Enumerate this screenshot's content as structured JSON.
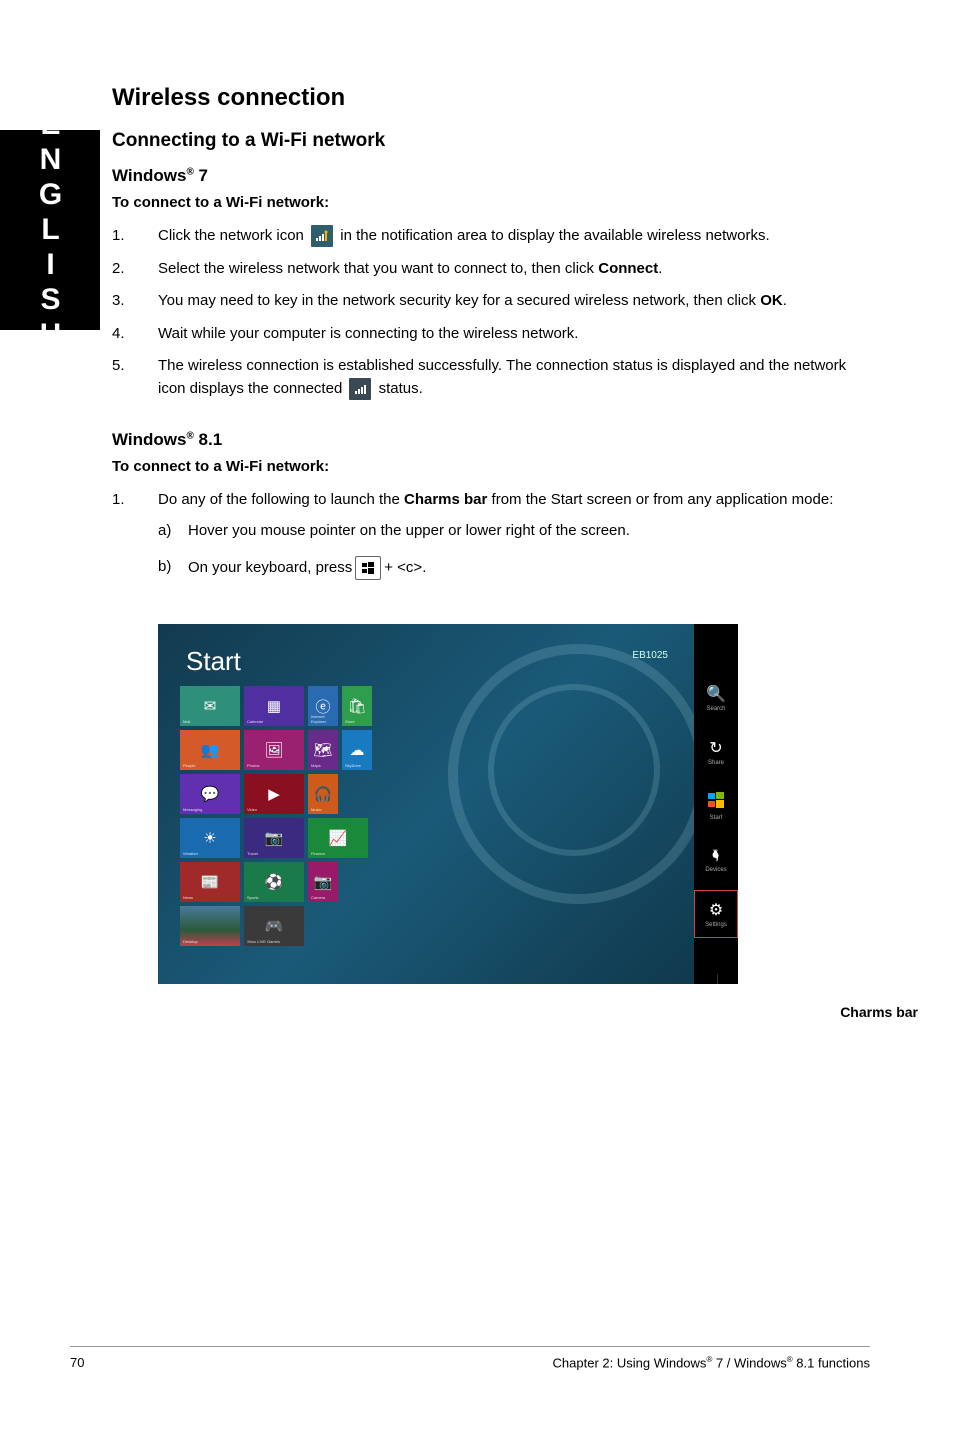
{
  "sideTab": "ENGLISH",
  "h1": "Wireless connection",
  "h2": "Connecting to a Wi-Fi network",
  "win7": {
    "heading_pre": "Windows",
    "heading_sup": "®",
    "heading_post": " 7",
    "subhead": "To connect to a Wi-Fi network:",
    "steps": [
      {
        "n": "1.",
        "pre": "Click the network icon ",
        "post": " in the notification area to display the available wireless networks."
      },
      {
        "n": "2.",
        "pre": "Select the wireless network that you want to connect to, then click ",
        "bold": "Connect",
        "post": "."
      },
      {
        "n": "3.",
        "pre": "You may need to key in the network security key for a secured wireless network, then click ",
        "bold": "OK",
        "post": "."
      },
      {
        "n": "4.",
        "pre": "Wait while your computer is connecting to the wireless network.",
        "bold": "",
        "post": ""
      },
      {
        "n": "5.",
        "pre": "The wireless connection is established successfully. The connection status is displayed and the network icon displays the connected ",
        "post": " status."
      }
    ]
  },
  "win81": {
    "heading_pre": "Windows",
    "heading_sup": "®",
    "heading_post": " 8.1",
    "subhead": "To connect to a Wi-Fi network:",
    "step1_n": "1.",
    "step1_pre": "Do any of the following to launch the ",
    "step1_bold": "Charms bar",
    "step1_post": " from the Start screen or from any application mode:",
    "sub_a_n": "a)",
    "sub_a": "Hover you mouse pointer on the upper or lower right of the screen.",
    "sub_b_n": "b)",
    "sub_b_pre": "On your keyboard, press ",
    "sub_b_post": " + <c>."
  },
  "screenshot": {
    "title": "Start",
    "user": "EB1025",
    "tiles": {
      "mail": "Mail",
      "calendar": "Calendar",
      "ie": "Internet Explorer",
      "store": "Store",
      "people": "People",
      "photos": "Photos",
      "maps": "Maps",
      "skydrive": "SkyDrive",
      "messaging": "Messaging",
      "video": "Video",
      "music": "Music",
      "weather": "Weather",
      "travel": "Travel",
      "finance": "Finance",
      "news": "News",
      "sports": "Sports",
      "camera": "Camera",
      "desktop": "Desktop",
      "xbox": "Xbox LIVE Games"
    },
    "charms": [
      {
        "icon": "🔍",
        "label": "Search"
      },
      {
        "icon": "↻",
        "label": "Share"
      },
      {
        "icon": "⊞",
        "label": "Start"
      },
      {
        "icon": "🖣",
        "label": "Devices"
      },
      {
        "icon": "⚙",
        "label": "Settings"
      }
    ],
    "charms_label": "Charms bar"
  },
  "footer": {
    "page": "70",
    "right_pre": "Chapter 2: Using Windows",
    "right_sup": "®",
    "right_mid": " 7 / Windows",
    "right_post": " 8.1 functions"
  }
}
